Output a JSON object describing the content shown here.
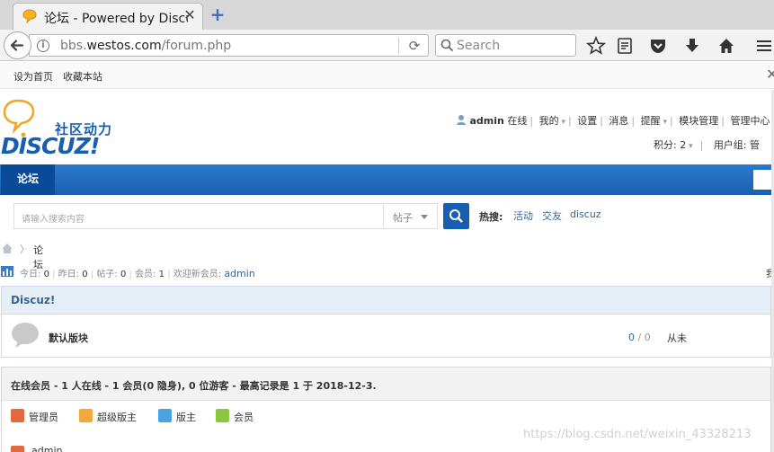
{
  "browser": {
    "tab_title": "论坛 - Powered by Discuz!",
    "url_prefix": "bbs.",
    "url_domain": "westos.com",
    "url_path": "/forum.php",
    "search_placeholder": "Search",
    "close_symbol": "✕",
    "newtab_symbol": "+"
  },
  "bookmarks": {
    "set_home": "设为首页",
    "bookmark_site": "收藏本站",
    "close": "✕"
  },
  "header": {
    "logo_cn": "社区动力",
    "logo_en": "DISCUZ!",
    "username": "admin",
    "online": "在线",
    "my": "我的",
    "settings": "设置",
    "messages": "消息",
    "notices": "提醒",
    "module_manage": "模块管理",
    "admin_center": "管理中心",
    "credits_label": "积分: 2",
    "usergroup_label": "用户组: 管"
  },
  "nav": {
    "forum": "论坛"
  },
  "search": {
    "placeholder": "请输入搜索内容",
    "type": "帖子",
    "hot_label": "热搜:",
    "hot_items": [
      "活动",
      "交友",
      "discuz"
    ]
  },
  "breadcrumb": {
    "arrow": "〉",
    "current": "论坛"
  },
  "stats": {
    "today_label": "今日:",
    "today": "0",
    "yesterday_label": "昨日:",
    "yesterday": "0",
    "posts_label": "帖子:",
    "posts": "0",
    "members_label": "会员:",
    "members": "1",
    "welcome_label": "欢迎新会员:",
    "newest_member": "admin",
    "right_text": "我"
  },
  "forum_group": {
    "title": "Discuz!",
    "forum_name": "默认版块",
    "threads": "0",
    "posts": "0",
    "last_post": "从未"
  },
  "online": {
    "title": "在线会员 - 1 人在线 - 1 会员(0 隐身), 0 位游客 - 最高记录是 1 于 2018-12-3.",
    "legend": [
      {
        "label": "管理员",
        "color": "#e06a3b"
      },
      {
        "label": "超级版主",
        "color": "#f2a93b"
      },
      {
        "label": "版主",
        "color": "#4aa3df"
      },
      {
        "label": "会员",
        "color": "#8cc63f"
      }
    ],
    "user": "admin"
  },
  "watermark": "https://blog.csdn.net/weixin_43328213"
}
